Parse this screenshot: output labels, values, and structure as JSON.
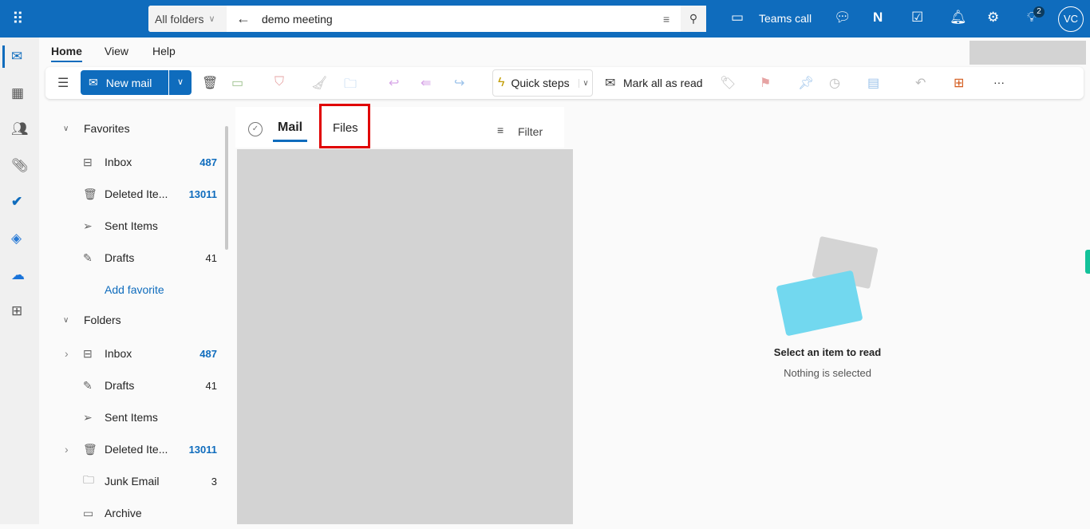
{
  "topbar": {
    "scope": "All folders",
    "search_value": "demo meeting",
    "teams_call": "Teams call",
    "badge": "2",
    "avatar": "VC",
    "bg": "#0f6cbd"
  },
  "ribbon": {
    "tabs": [
      "Home",
      "View",
      "Help"
    ],
    "new_mail": "New mail",
    "quick_steps": "Quick steps",
    "mark_all_read": "Mark all as read",
    "more": "···"
  },
  "favorites": {
    "header": "Favorites",
    "items": [
      {
        "label": "Inbox",
        "count": "487",
        "icon": "inbox"
      },
      {
        "label": "Deleted Ite...",
        "count": "13011",
        "icon": "trash"
      },
      {
        "label": "Sent Items",
        "count": "",
        "icon": "send"
      },
      {
        "label": "Drafts",
        "count": "41",
        "icon": "pencil"
      }
    ],
    "add": "Add favorite"
  },
  "folders": {
    "header": "Folders",
    "items": [
      {
        "label": "Inbox",
        "count": "487"
      },
      {
        "label": "Drafts",
        "count": "41"
      },
      {
        "label": "Sent Items",
        "count": ""
      },
      {
        "label": "Deleted Ite...",
        "count": "13011"
      },
      {
        "label": "Junk Email",
        "count": "3"
      },
      {
        "label": "Archive",
        "count": ""
      }
    ]
  },
  "list": {
    "tabs": [
      "Mail",
      "Files"
    ],
    "filter": "Filter"
  },
  "reading": {
    "title": "Select an item to read",
    "subtitle": "Nothing is selected"
  }
}
